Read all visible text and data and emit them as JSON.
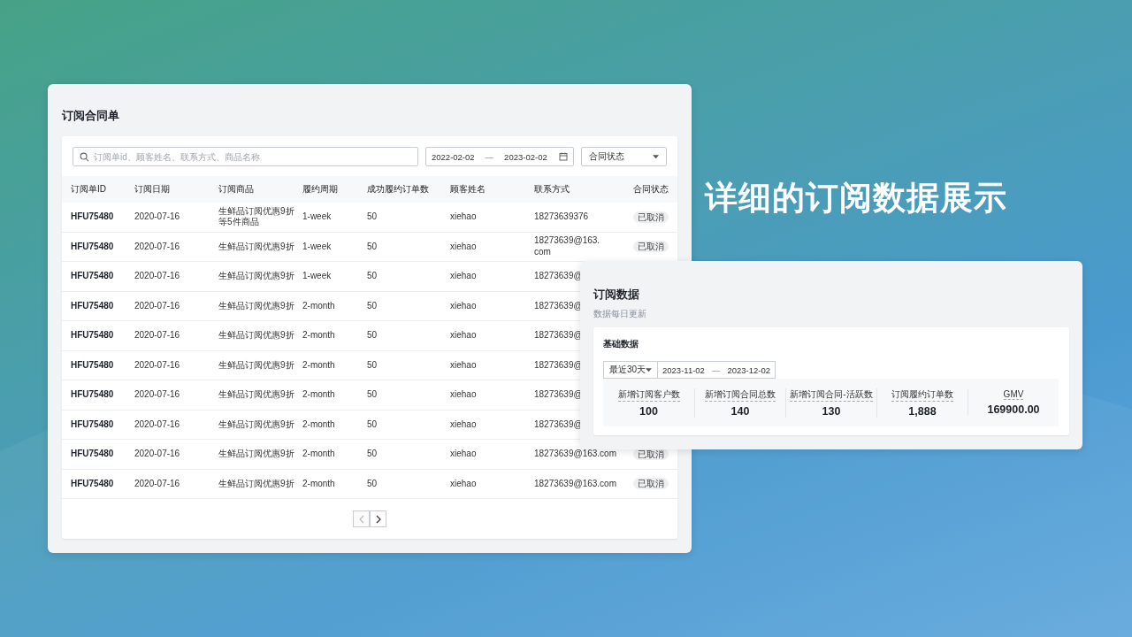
{
  "contract_panel": {
    "title": "订阅合同单",
    "search": {
      "placeholder": "订阅单id、顾客姓名、联系方式、商品名称"
    },
    "date_range": {
      "start": "2022-02-02",
      "separator": "—",
      "end": "2023-02-02"
    },
    "status_select": {
      "value": "合同状态"
    },
    "table": {
      "columns": [
        "订阅单ID",
        "订阅日期",
        "订阅商品",
        "履约周期",
        "成功履约订单数",
        "顾客姓名",
        "联系方式",
        "合同状态"
      ],
      "rows": [
        {
          "id": "HFU75480",
          "date": "2020-07-16",
          "product": "生鲜品订阅优惠9折等5件商品",
          "cycle": "1-week",
          "orders": "50",
          "customer": "xiehao",
          "contact": "18273639376",
          "status": "已取消"
        },
        {
          "id": "HFU75480",
          "date": "2020-07-16",
          "product": "生鲜品订阅优惠9折",
          "cycle": "1-week",
          "orders": "50",
          "customer": "xiehao",
          "contact": "18273639@163.\ncom",
          "status": "已取消"
        },
        {
          "id": "HFU75480",
          "date": "2020-07-16",
          "product": "生鲜品订阅优惠9折",
          "cycle": "1-week",
          "orders": "50",
          "customer": "xiehao",
          "contact": "18273639@"
        },
        {
          "id": "HFU75480",
          "date": "2020-07-16",
          "product": "生鲜品订阅优惠9折",
          "cycle": "2-month",
          "orders": "50",
          "customer": "xiehao",
          "contact": "18273639@"
        },
        {
          "id": "HFU75480",
          "date": "2020-07-16",
          "product": "生鲜品订阅优惠9折",
          "cycle": "2-month",
          "orders": "50",
          "customer": "xiehao",
          "contact": "18273639@"
        },
        {
          "id": "HFU75480",
          "date": "2020-07-16",
          "product": "生鲜品订阅优惠9折",
          "cycle": "2-month",
          "orders": "50",
          "customer": "xiehao",
          "contact": "18273639@"
        },
        {
          "id": "HFU75480",
          "date": "2020-07-16",
          "product": "生鲜品订阅优惠9折",
          "cycle": "2-month",
          "orders": "50",
          "customer": "xiehao",
          "contact": "18273639@"
        },
        {
          "id": "HFU75480",
          "date": "2020-07-16",
          "product": "生鲜品订阅优惠9折",
          "cycle": "2-month",
          "orders": "50",
          "customer": "xiehao",
          "contact": "18273639@"
        },
        {
          "id": "HFU75480",
          "date": "2020-07-16",
          "product": "生鲜品订阅优惠9折",
          "cycle": "2-month",
          "orders": "50",
          "customer": "xiehao",
          "contact": "18273639@163.com",
          "status": "已取消"
        },
        {
          "id": "HFU75480",
          "date": "2020-07-16",
          "product": "生鲜品订阅优惠9折",
          "cycle": "2-month",
          "orders": "50",
          "customer": "xiehao",
          "contact": "18273639@163.com",
          "status": "已取消"
        }
      ]
    },
    "pagination": {
      "prev_disabled": true,
      "next_disabled": false
    }
  },
  "headline": "详细的订阅数据展示",
  "stats_panel": {
    "title": "订阅数据",
    "subtitle": "数据每日更新",
    "section_title": "基础数据",
    "period_select": {
      "value": "最近30天"
    },
    "date_range": {
      "start": "2023-11-02",
      "separator": "—",
      "end": "2023-12-02"
    },
    "stats": [
      {
        "label": "新增订阅客户数",
        "value": "100"
      },
      {
        "label": "新增订阅合同总数",
        "value": "140"
      },
      {
        "label": "新增订阅合同-活跃数",
        "value": "130"
      },
      {
        "label": "订阅履约订单数",
        "value": "1,888"
      },
      {
        "label": "GMV",
        "value": "169900.00"
      }
    ]
  }
}
